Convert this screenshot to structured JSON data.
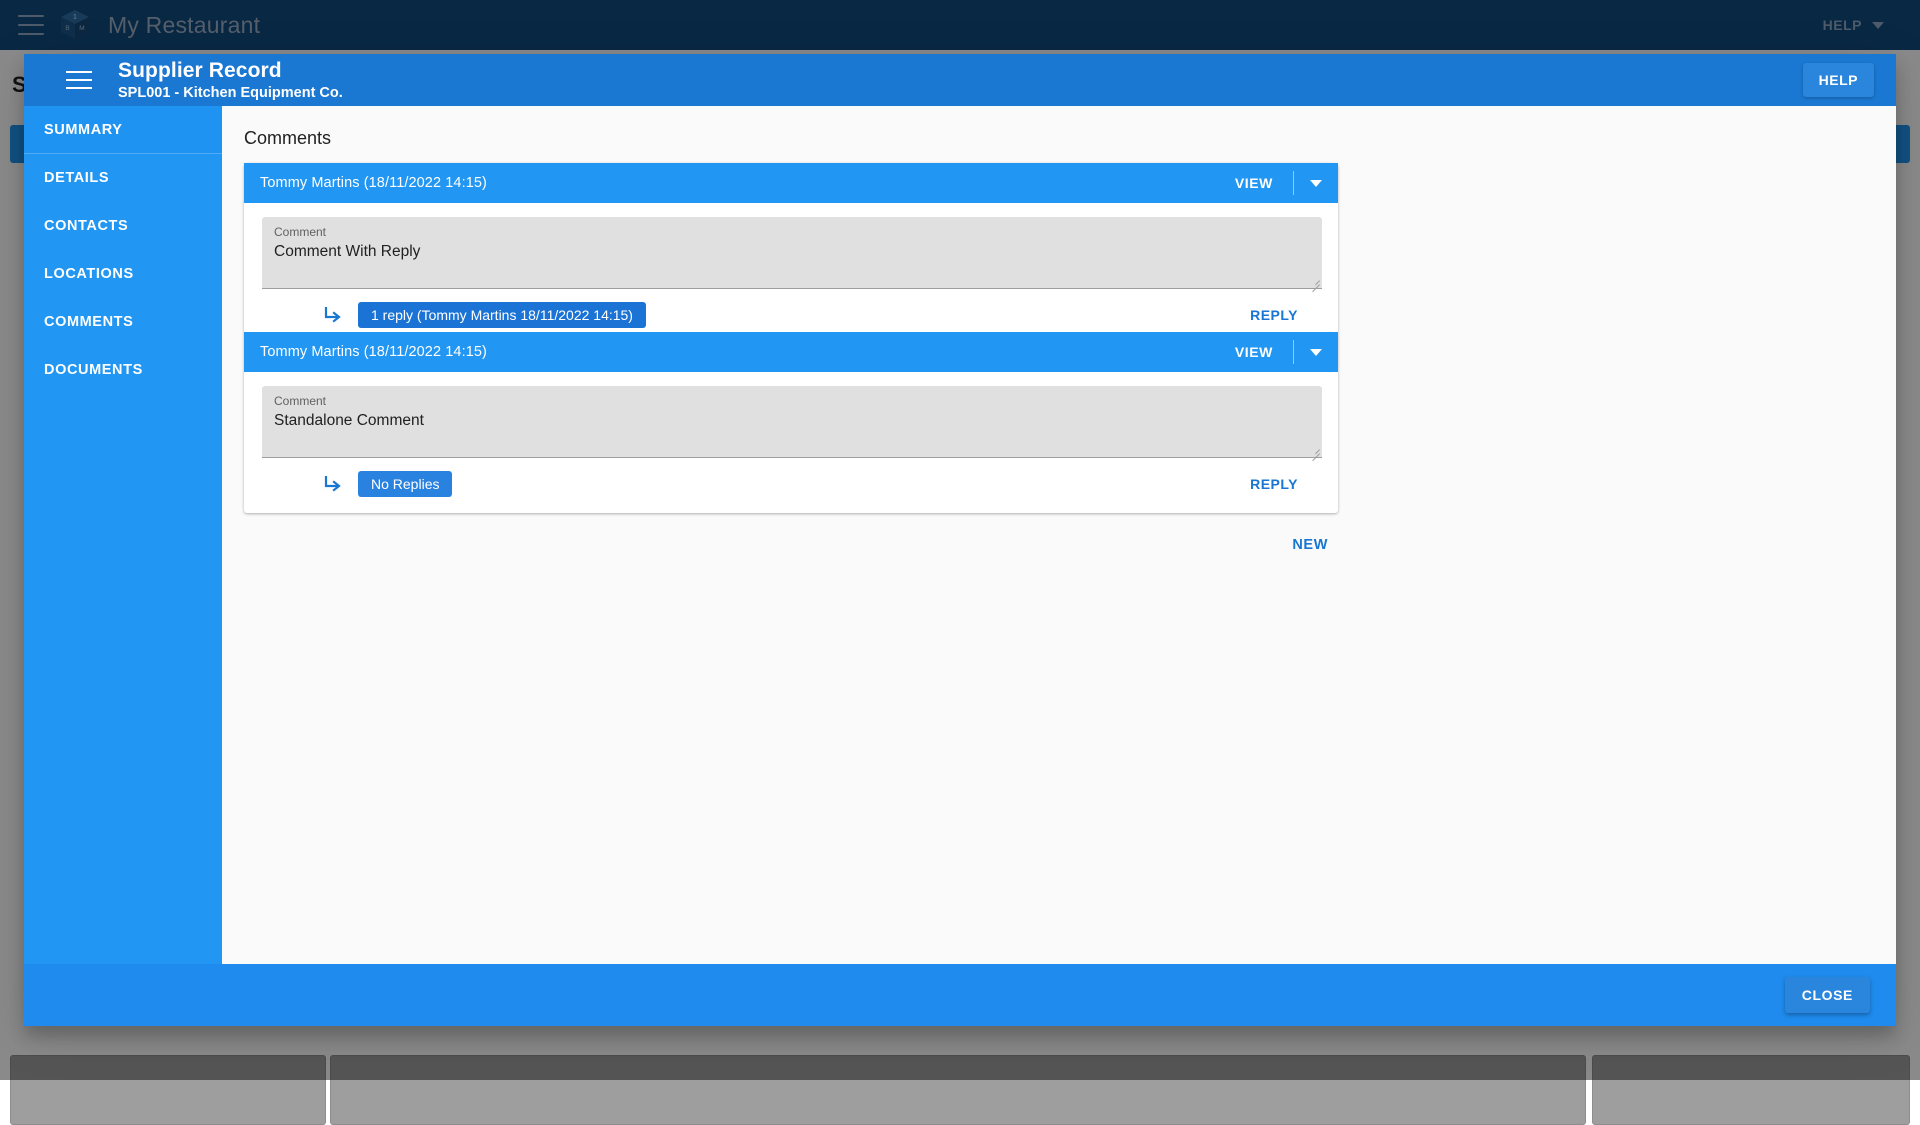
{
  "appbar": {
    "menu_icon": "hamburger-menu-icon",
    "logo_icon": "cube-logo-icon",
    "logo_faces": {
      "top": "1",
      "left": "B",
      "right": "M"
    },
    "title": "My Restaurant",
    "help_label": "HELP"
  },
  "background": {
    "heading": "S",
    "cards": 3
  },
  "dialog": {
    "menu_icon": "hamburger-menu-icon",
    "title": "Supplier Record",
    "subtitle": "SPL001 - Kitchen Equipment Co.",
    "help_label": "HELP",
    "close_label": "CLOSE"
  },
  "nav": {
    "items": [
      {
        "label": "SUMMARY",
        "active": false,
        "first": true
      },
      {
        "label": "DETAILS",
        "active": false,
        "first": false
      },
      {
        "label": "CONTACTS",
        "active": false,
        "first": false
      },
      {
        "label": "LOCATIONS",
        "active": false,
        "first": false
      },
      {
        "label": "COMMENTS",
        "active": true,
        "first": false
      },
      {
        "label": "DOCUMENTS",
        "active": false,
        "first": false
      }
    ]
  },
  "content": {
    "section_title": "Comments",
    "new_label": "NEW",
    "comments": [
      {
        "author_line": "Tommy Martins (18/11/2022 14:15)",
        "view_label": "VIEW",
        "dropdown_icon": "chevron-down-icon",
        "field_label": "Comment",
        "field_value": "Comment With Reply",
        "reply_arrow_icon": "reply-arrow-icon",
        "replies_chip": "1 reply (Tommy Martins 18/11/2022 14:15)",
        "reply_label": "REPLY"
      },
      {
        "author_line": "Tommy Martins (18/11/2022 14:15)",
        "view_label": "VIEW",
        "dropdown_icon": "chevron-down-icon",
        "field_label": "Comment",
        "field_value": "Standalone Comment",
        "reply_arrow_icon": "reply-arrow-icon",
        "replies_chip": "No Replies",
        "reply_label": "REPLY"
      }
    ]
  },
  "colors": {
    "appbar_bg": "#124a7f",
    "primary": "#2196f3",
    "dialog_header": "#1a78d2",
    "dialog_footer": "#1f8bee",
    "chip": "#1a73d5",
    "link": "#1976d2",
    "field_bg": "#e0e0e0"
  }
}
